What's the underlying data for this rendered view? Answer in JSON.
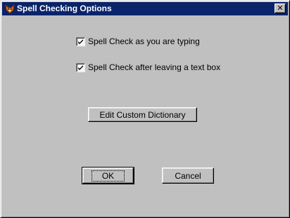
{
  "window": {
    "title": "Spell Checking Options",
    "app_icon": "fox-icon",
    "close_symbol": "✕"
  },
  "options": [
    {
      "label": "Spell Check as you are typing",
      "checked": true
    },
    {
      "label": "Spell Check after leaving a text box",
      "checked": true
    }
  ],
  "buttons": {
    "edit_dictionary": "Edit Custom Dictionary",
    "ok": "OK",
    "cancel": "Cancel"
  },
  "colors": {
    "titlebar": "#0a246a",
    "face": "#c0c0c0"
  }
}
